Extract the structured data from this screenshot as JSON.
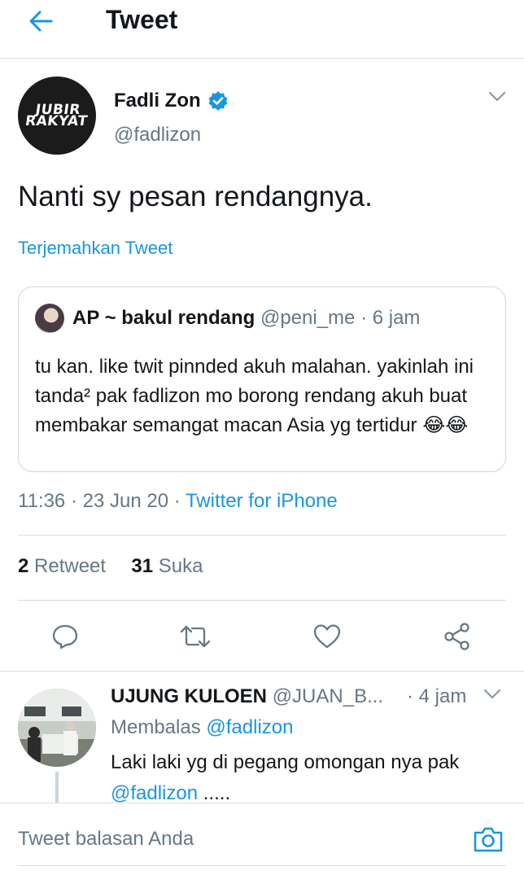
{
  "header": {
    "title": "Tweet"
  },
  "tweet": {
    "author_name": "Fadli Zon",
    "author_handle": "@fadlizon",
    "avatar_logo_line1": "JUBIR",
    "avatar_logo_line2": "RAKYAT",
    "text": "Nanti sy pesan rendangnya.",
    "translate_label": "Terjemahkan Tweet",
    "quote": {
      "name": "AP ~ bakul rendang",
      "handle": "@peni_me",
      "time": "· 6 jam",
      "text": "tu kan. like twit pinnded akuh malahan. yakinlah ini tanda² pak fadlizon mo borong rendang akuh buat membakar semangat macan Asia yg tertidur 😂😂"
    },
    "time": "11:36",
    "date": "23 Jun 20",
    "source": "Twitter for iPhone",
    "retweet_count": "2",
    "retweet_label": "Retweet",
    "like_count": "31",
    "like_label": "Suka"
  },
  "reply": {
    "name": "UJUNG KULOEN",
    "handle": "@JUAN_B...",
    "time": "· 4 jam",
    "replying_prefix": "Membalas",
    "replying_to": "@fadlizon",
    "text": "Laki laki yg di pegang omongan nya pak",
    "mention": "@fadlizon",
    "text_suffix": "....."
  },
  "composer": {
    "placeholder": "Tweet balasan Anda"
  },
  "colors": {
    "accent": "#1b95e0",
    "text": "#14171a",
    "secondary": "#657786",
    "border": "#d9dde0"
  },
  "icons": [
    "back-arrow-icon",
    "verified-badge-icon",
    "chevron-down-icon",
    "reply-icon",
    "retweet-icon",
    "like-icon",
    "share-icon",
    "camera-icon"
  ]
}
